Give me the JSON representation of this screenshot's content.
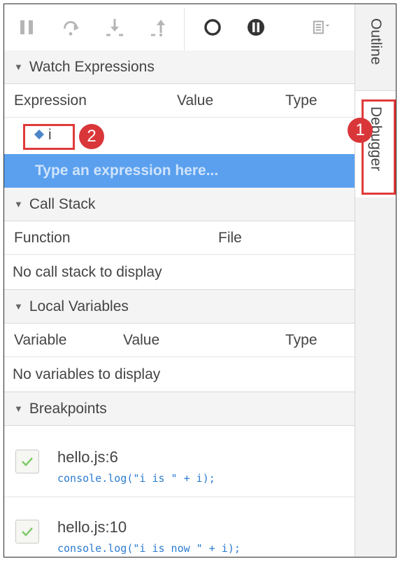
{
  "side_tabs": {
    "outline": "Outline",
    "debugger": "Debugger"
  },
  "watch": {
    "header": "Watch Expressions",
    "columns": {
      "expression": "Expression",
      "value": "Value",
      "type": "Type"
    },
    "items": [
      {
        "name": "i"
      }
    ],
    "placeholder": "Type an expression here..."
  },
  "call_stack": {
    "header": "Call Stack",
    "columns": {
      "function": "Function",
      "file": "File"
    },
    "empty": "No call stack to display"
  },
  "locals": {
    "header": "Local Variables",
    "columns": {
      "variable": "Variable",
      "value": "Value",
      "type": "Type"
    },
    "empty": "No variables to display"
  },
  "breakpoints": {
    "header": "Breakpoints",
    "items": [
      {
        "file": "hello.js:6",
        "code": "console.log(\"i is \" + i);"
      },
      {
        "file": "hello.js:10",
        "code": "console.log(\"i is now \" + i);"
      }
    ]
  },
  "callouts": {
    "one": "1",
    "two": "2"
  },
  "colors": {
    "highlight": "#5aa0ef",
    "callout": "#d9363a",
    "code": "#2b7bd1"
  }
}
